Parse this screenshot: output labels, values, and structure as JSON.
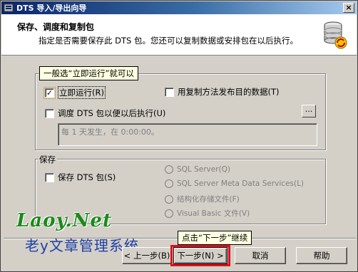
{
  "window": {
    "title": "DTS 导入/导出向导",
    "close_glyph": "×"
  },
  "header": {
    "title": "保存、调度和复制包",
    "subtitle": "指定是否需要保存此 DTS 包。您还可以复制数据或安排包在以后执行。"
  },
  "tooltips": {
    "top": "一般选“立即运行”就可以",
    "bottom": "点击“下一步”继续"
  },
  "when_group": {
    "run_now": "立即运行(R)",
    "replicate": "用复制方法发布目的数据(T)",
    "schedule": "调度 DTS 包以便以后执行(U)",
    "schedule_button": "...",
    "schedule_text": "每 1 天发生，在 0:00:00。",
    "run_now_checked": true,
    "replicate_checked": false,
    "schedule_checked": false
  },
  "save_group": {
    "legend": "保存",
    "save_dts": "保存 DTS 包(S)",
    "save_dts_checked": false,
    "options": [
      "SQL Server(Q)",
      "SQL Server Meta Data Services(L)",
      "结构化存储文件(F)",
      "Visual Basic 文件(V)"
    ]
  },
  "watermark": {
    "title": "Laoy.Net",
    "subtitle": "老y文章管理系统"
  },
  "buttons": {
    "back": "< 上一步(B)",
    "next": "下一步(N) >",
    "cancel": "取消",
    "help": "帮助"
  },
  "colors": {
    "title_bar": "#0a246a",
    "highlight_red": "#e0101c",
    "watermark_green": "#1a8a1a",
    "watermark_blue": "#1e3fa8"
  }
}
